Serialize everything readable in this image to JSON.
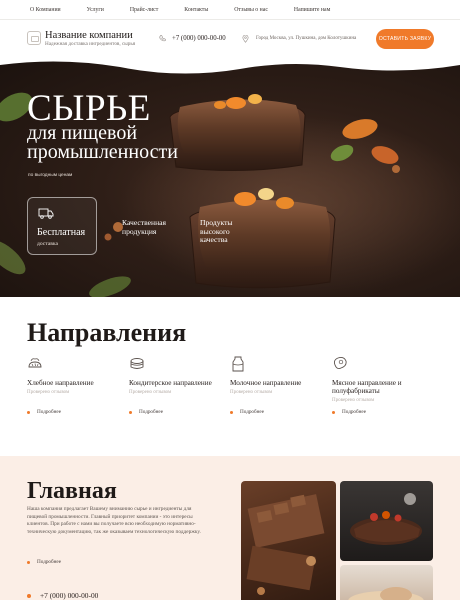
{
  "topnav": {
    "items": [
      "О Компании",
      "Услуги",
      "Прайс-лист",
      "Контакты",
      "Отзывы о нас",
      "Напишите нам"
    ]
  },
  "header": {
    "company_name": "Название компании",
    "company_tag": "Надежная доставка ингредиентов, сырья",
    "phone": "+7 (000) 000-00-00",
    "address": "Город Москва, ул. Пушкина, дом Колотушкина",
    "callback_label": "ОСТАВИТЬ ЗАЯВКУ"
  },
  "hero": {
    "title": "СЫРЬЕ",
    "subtitle_line1": "для пищевой",
    "subtitle_line2": "промышленности",
    "small": "по выгодным ценам",
    "feature1_title": "Бесплатная",
    "feature1_sub": "доставка",
    "feature2": "Качественная продукция",
    "feature3": "Продукты высокого качества"
  },
  "directions": {
    "title": "Направления",
    "items": [
      {
        "name": "Хлебное направление",
        "tag": "Проверено отзывом",
        "more": "Подробнее",
        "icon": "bread-icon"
      },
      {
        "name": "Кондитерское направление",
        "tag": "Проверено отзывом",
        "more": "Подробнее",
        "icon": "cake-icon"
      },
      {
        "name": "Молочное направление",
        "tag": "Проверено отзывом",
        "more": "Подробнее",
        "icon": "milk-icon"
      },
      {
        "name": "Мясное направление и полуфабрикаты",
        "tag": "Проверено отзывом",
        "more": "Подробнее",
        "icon": "meat-icon"
      }
    ]
  },
  "about": {
    "title": "Главная",
    "text": "Наша компания предлагает Вашему вниманию сырье и ингредиенты для пищевой промышленности. Главный приоритет компании - это интересы клиентов. При работе с нами вы получаете всю необходимую нормативно-техническую документацию, так же оказываем технологическую поддержку.",
    "more": "Подробнее",
    "phone": "+7 (000) 000-00-00"
  },
  "colors": {
    "accent": "#f07a2a",
    "about_bg": "#fbeee6"
  }
}
